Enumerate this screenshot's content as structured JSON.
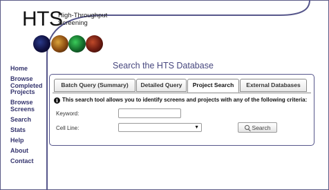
{
  "logo": {
    "title": "HTS",
    "subtitle_line1": "High-Throughput",
    "subtitle_line2": "Screening"
  },
  "thumbnails": [
    "blue-cells-thumbnail",
    "orange-cells-thumbnail",
    "green-cells-thumbnail",
    "red-cells-thumbnail"
  ],
  "nav": {
    "home": "Home",
    "browse_completed_1": "Browse",
    "browse_completed_2": "Completed",
    "browse_completed_3": "Projects",
    "browse_screens_1": "Browse",
    "browse_screens_2": "Screens",
    "search": "Search",
    "stats": "Stats",
    "help": "Help",
    "about": "About",
    "contact": "Contact"
  },
  "page_title": "Search the HTS Database",
  "tabs": {
    "batch": "Batch Query (Summary)",
    "detailed": "Detailed Query",
    "project": "Project Search",
    "external": "External Databases",
    "active": "Project Search"
  },
  "form": {
    "info_icon": "i",
    "info_text": "This search tool allows you to identify screens and projects with any of the following criteria:",
    "keyword_label": "Keyword:",
    "keyword_value": "",
    "cell_line_label": "Cell Line:",
    "cell_line_value": "",
    "search_button": "Search"
  },
  "colors": {
    "accent": "#35356e",
    "border": "#5a5a86"
  }
}
